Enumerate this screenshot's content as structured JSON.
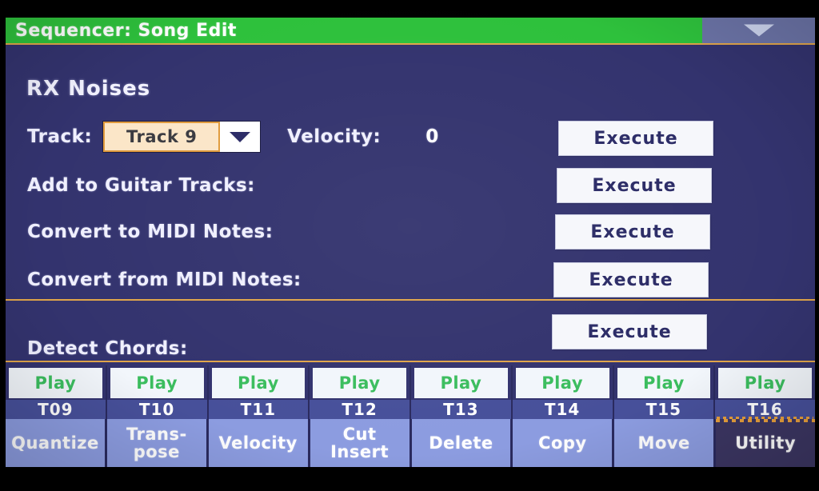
{
  "titlebar": {
    "title": "Sequencer: Song Edit",
    "page_menu_icon": "chevron-down-icon",
    "green_hex": "#2ec13c",
    "underline_hex": "#e0a54a"
  },
  "section": {
    "heading": "RX Noises"
  },
  "params": {
    "track": {
      "label": "Track:",
      "value": "Track 9",
      "dropdown_icon": "chevron-down-icon"
    },
    "velocity": {
      "label": "Velocity:",
      "value": "0"
    },
    "rows": [
      {
        "label": "Add to Guitar Tracks:",
        "action": "Execute"
      },
      {
        "label": "Convert to MIDI Notes:",
        "action": "Execute"
      },
      {
        "label": "Convert from MIDI Notes:",
        "action": "Execute"
      }
    ],
    "track_row_action": "Execute",
    "detect_chords": {
      "label": "Detect Chords:",
      "action": "Execute"
    }
  },
  "tracks": [
    {
      "play": "Play",
      "name": "T09",
      "selected": false
    },
    {
      "play": "Play",
      "name": "T10",
      "selected": false
    },
    {
      "play": "Play",
      "name": "T11",
      "selected": false
    },
    {
      "play": "Play",
      "name": "T12",
      "selected": false
    },
    {
      "play": "Play",
      "name": "T13",
      "selected": false
    },
    {
      "play": "Play",
      "name": "T14",
      "selected": false
    },
    {
      "play": "Play",
      "name": "T15",
      "selected": false
    },
    {
      "play": "Play",
      "name": "T16",
      "selected": true
    }
  ],
  "tabs": [
    {
      "line1": "Quantize",
      "line2": "",
      "active": false
    },
    {
      "line1": "Trans-",
      "line2": "pose",
      "active": false
    },
    {
      "line1": "Velocity",
      "line2": "",
      "active": false
    },
    {
      "line1": "Cut",
      "line2": "Insert",
      "active": false
    },
    {
      "line1": "Delete",
      "line2": "",
      "active": false
    },
    {
      "line1": "Copy",
      "line2": "",
      "active": false
    },
    {
      "line1": "Move",
      "line2": "",
      "active": false
    },
    {
      "line1": "Utility",
      "line2": "",
      "active": true
    }
  ],
  "colors": {
    "lcd_background": "#33336e",
    "title_green": "#2ec13c",
    "divider_orange": "#e0a54a",
    "tab_blue": "#8c9ce0",
    "tab_active": "#3c3663",
    "play_green": "#3bbd5e",
    "track_blue": "#47509a",
    "combo_fill": "#fbe6c8",
    "combo_border": "#e09a3c"
  }
}
